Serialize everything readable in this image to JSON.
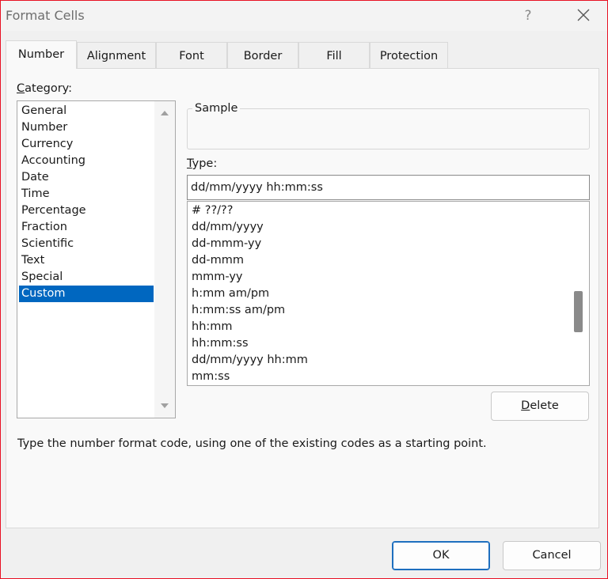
{
  "window": {
    "title": "Format Cells",
    "help_label": "?"
  },
  "tabs": [
    {
      "label": "Number",
      "active": true
    },
    {
      "label": "Alignment"
    },
    {
      "label": "Font"
    },
    {
      "label": "Border"
    },
    {
      "label": "Fill"
    },
    {
      "label": "Protection"
    }
  ],
  "category": {
    "label_mnemonic": "C",
    "label_rest": "ategory:",
    "items": [
      "General",
      "Number",
      "Currency",
      "Accounting",
      "Date",
      "Time",
      "Percentage",
      "Fraction",
      "Scientific",
      "Text",
      "Special",
      "Custom"
    ],
    "selected": "Custom"
  },
  "sample": {
    "label": "Sample",
    "value": ""
  },
  "type": {
    "label_mnemonic": "T",
    "label_rest": "ype:",
    "value": "dd/mm/yyyy hh:mm:ss",
    "items": [
      "# ??/??",
      "dd/mm/yyyy",
      "dd-mmm-yy",
      "dd-mmm",
      "mmm-yy",
      "h:mm am/pm",
      "h:mm:ss am/pm",
      "hh:mm",
      "hh:mm:ss",
      "dd/mm/yyyy hh:mm",
      "mm:ss"
    ]
  },
  "delete_button": {
    "mnemonic": "D",
    "rest": "elete"
  },
  "hint": "Type the number format code, using one of the existing codes as a starting point.",
  "footer": {
    "ok_label": "OK",
    "cancel_label": "Cancel"
  },
  "colors": {
    "selection": "#0067c0",
    "primary_border": "#1e6fbf",
    "window_border": "#e81123"
  }
}
